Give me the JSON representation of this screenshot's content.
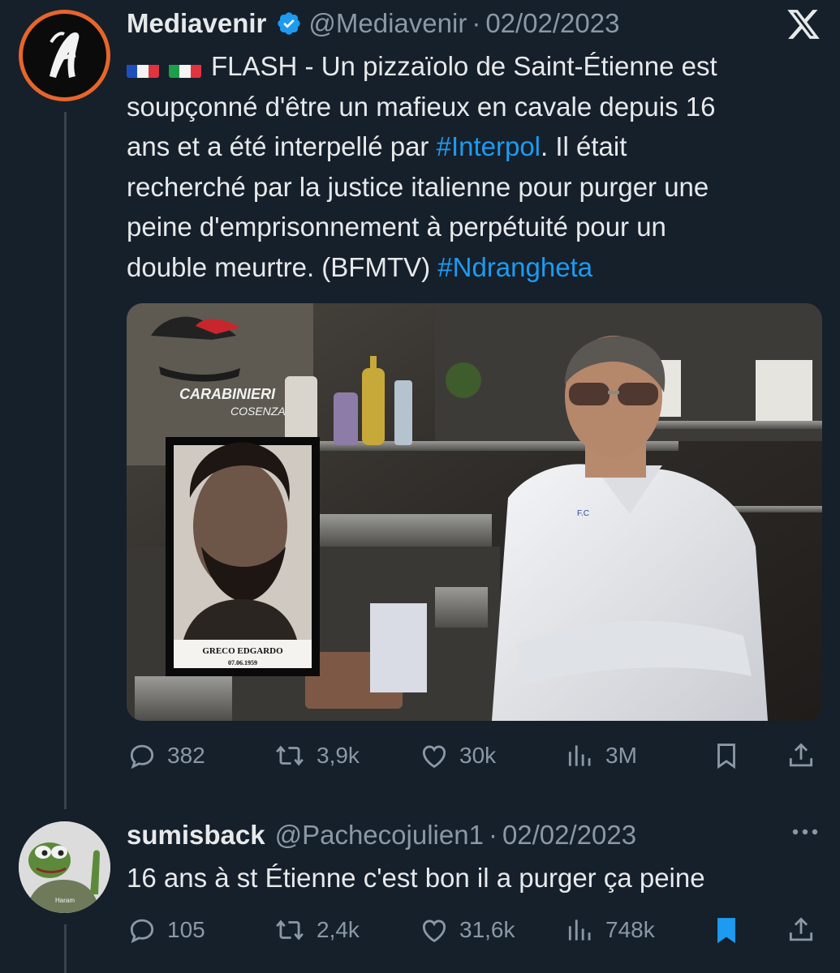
{
  "tweet": {
    "name": "Mediavenir",
    "handle": "@Mediavenir",
    "separator": "·",
    "date": "02/02/2023",
    "text_parts": {
      "l1": "FLASH - Un pizzaïolo de Saint-Étienne est",
      "l2": "soupçonné d'être un mafieux en cavale depuis 16",
      "l3a": "ans et a été interpellé par ",
      "l3tag": "#Interpol",
      "l3b": ". Il était",
      "l4": "recherché par la justice italienne pour purger une",
      "l5": "peine d'emprisonnement à perpétuité pour un",
      "l6a": "double meurtre. (BFMTV) ",
      "l6tag": "#Ndrangheta"
    },
    "media": {
      "watermark_line1": "CARABINIERI",
      "watermark_line2": "COSENZA",
      "mugshot_name": "GRECO EDGARDO",
      "mugshot_date": "07.06.1959",
      "jacket_badge": "F.C"
    },
    "stats": {
      "replies": "382",
      "retweets": "3,9k",
      "likes": "30k",
      "views": "3M"
    }
  },
  "reply": {
    "name": "sumisback",
    "handle": "@Pachecojulien1",
    "separator": "·",
    "date": "02/02/2023",
    "text": "16 ans à st Étienne c'est bon il a purger ça peine",
    "avatar_caption": "Haram",
    "stats": {
      "replies": "105",
      "retweets": "2,4k",
      "likes": "31,6k",
      "views": "748k"
    },
    "bookmarked": true
  },
  "colors": {
    "background": "#15202b",
    "text": "#e7e9ea",
    "muted": "#8b98a5",
    "accent": "#1d9bf0",
    "avatar_ring": "#e8652a"
  },
  "icons": [
    "x-logo-icon",
    "verified-badge-icon",
    "flag-fr-icon",
    "flag-it-icon",
    "reply-icon",
    "retweet-icon",
    "like-icon",
    "views-icon",
    "bookmark-icon",
    "share-icon",
    "more-icon"
  ]
}
